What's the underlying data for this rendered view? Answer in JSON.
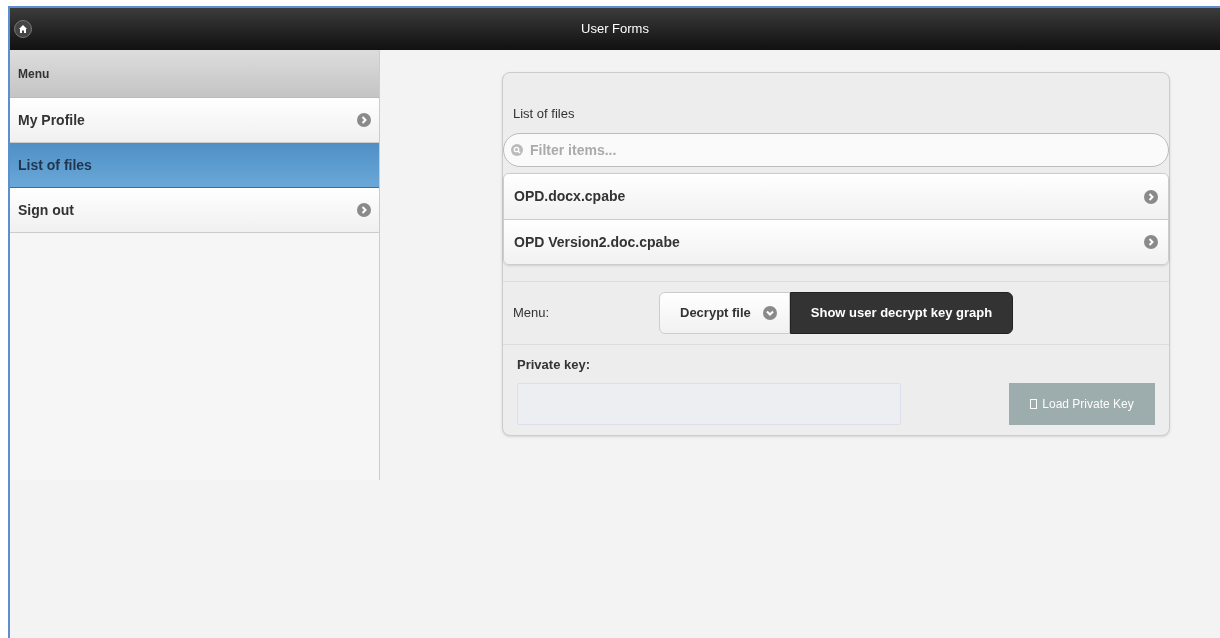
{
  "header": {
    "title": "User Forms"
  },
  "sidebar": {
    "heading": "Menu",
    "items": [
      {
        "label": "My Profile",
        "selected": false,
        "has_arrow": true
      },
      {
        "label": "List of files",
        "selected": true,
        "has_arrow": false
      },
      {
        "label": "Sign out",
        "selected": false,
        "has_arrow": true
      }
    ]
  },
  "panel": {
    "title": "List of files",
    "filter": {
      "placeholder": "Filter items..."
    },
    "files": [
      {
        "name": "OPD.docx.cpabe"
      },
      {
        "name": "OPD Version2.doc.cpabe"
      }
    ],
    "menu_label": "Menu:",
    "menu_options": [
      {
        "label": "Decrypt file",
        "selected": false,
        "kind": "dropdown"
      },
      {
        "label": "Show user decrypt key graph",
        "selected": true,
        "kind": "plain"
      }
    ],
    "private_key_label": "Private key:",
    "load_button": {
      "label": "Load Private Key",
      "disabled": true
    }
  }
}
